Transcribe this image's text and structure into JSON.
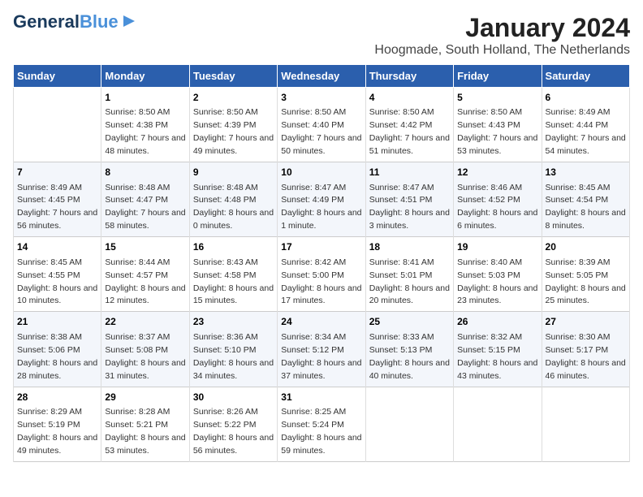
{
  "logo": {
    "line1": "General",
    "line2": "Blue"
  },
  "title": "January 2024",
  "subtitle": "Hoogmade, South Holland, The Netherlands",
  "headers": [
    "Sunday",
    "Monday",
    "Tuesday",
    "Wednesday",
    "Thursday",
    "Friday",
    "Saturday"
  ],
  "weeks": [
    [
      {
        "day": "",
        "sunrise": "",
        "sunset": "",
        "daylight": ""
      },
      {
        "day": "1",
        "sunrise": "Sunrise: 8:50 AM",
        "sunset": "Sunset: 4:38 PM",
        "daylight": "Daylight: 7 hours and 48 minutes."
      },
      {
        "day": "2",
        "sunrise": "Sunrise: 8:50 AM",
        "sunset": "Sunset: 4:39 PM",
        "daylight": "Daylight: 7 hours and 49 minutes."
      },
      {
        "day": "3",
        "sunrise": "Sunrise: 8:50 AM",
        "sunset": "Sunset: 4:40 PM",
        "daylight": "Daylight: 7 hours and 50 minutes."
      },
      {
        "day": "4",
        "sunrise": "Sunrise: 8:50 AM",
        "sunset": "Sunset: 4:42 PM",
        "daylight": "Daylight: 7 hours and 51 minutes."
      },
      {
        "day": "5",
        "sunrise": "Sunrise: 8:50 AM",
        "sunset": "Sunset: 4:43 PM",
        "daylight": "Daylight: 7 hours and 53 minutes."
      },
      {
        "day": "6",
        "sunrise": "Sunrise: 8:49 AM",
        "sunset": "Sunset: 4:44 PM",
        "daylight": "Daylight: 7 hours and 54 minutes."
      }
    ],
    [
      {
        "day": "7",
        "sunrise": "Sunrise: 8:49 AM",
        "sunset": "Sunset: 4:45 PM",
        "daylight": "Daylight: 7 hours and 56 minutes."
      },
      {
        "day": "8",
        "sunrise": "Sunrise: 8:48 AM",
        "sunset": "Sunset: 4:47 PM",
        "daylight": "Daylight: 7 hours and 58 minutes."
      },
      {
        "day": "9",
        "sunrise": "Sunrise: 8:48 AM",
        "sunset": "Sunset: 4:48 PM",
        "daylight": "Daylight: 8 hours and 0 minutes."
      },
      {
        "day": "10",
        "sunrise": "Sunrise: 8:47 AM",
        "sunset": "Sunset: 4:49 PM",
        "daylight": "Daylight: 8 hours and 1 minute."
      },
      {
        "day": "11",
        "sunrise": "Sunrise: 8:47 AM",
        "sunset": "Sunset: 4:51 PM",
        "daylight": "Daylight: 8 hours and 3 minutes."
      },
      {
        "day": "12",
        "sunrise": "Sunrise: 8:46 AM",
        "sunset": "Sunset: 4:52 PM",
        "daylight": "Daylight: 8 hours and 6 minutes."
      },
      {
        "day": "13",
        "sunrise": "Sunrise: 8:45 AM",
        "sunset": "Sunset: 4:54 PM",
        "daylight": "Daylight: 8 hours and 8 minutes."
      }
    ],
    [
      {
        "day": "14",
        "sunrise": "Sunrise: 8:45 AM",
        "sunset": "Sunset: 4:55 PM",
        "daylight": "Daylight: 8 hours and 10 minutes."
      },
      {
        "day": "15",
        "sunrise": "Sunrise: 8:44 AM",
        "sunset": "Sunset: 4:57 PM",
        "daylight": "Daylight: 8 hours and 12 minutes."
      },
      {
        "day": "16",
        "sunrise": "Sunrise: 8:43 AM",
        "sunset": "Sunset: 4:58 PM",
        "daylight": "Daylight: 8 hours and 15 minutes."
      },
      {
        "day": "17",
        "sunrise": "Sunrise: 8:42 AM",
        "sunset": "Sunset: 5:00 PM",
        "daylight": "Daylight: 8 hours and 17 minutes."
      },
      {
        "day": "18",
        "sunrise": "Sunrise: 8:41 AM",
        "sunset": "Sunset: 5:01 PM",
        "daylight": "Daylight: 8 hours and 20 minutes."
      },
      {
        "day": "19",
        "sunrise": "Sunrise: 8:40 AM",
        "sunset": "Sunset: 5:03 PM",
        "daylight": "Daylight: 8 hours and 23 minutes."
      },
      {
        "day": "20",
        "sunrise": "Sunrise: 8:39 AM",
        "sunset": "Sunset: 5:05 PM",
        "daylight": "Daylight: 8 hours and 25 minutes."
      }
    ],
    [
      {
        "day": "21",
        "sunrise": "Sunrise: 8:38 AM",
        "sunset": "Sunset: 5:06 PM",
        "daylight": "Daylight: 8 hours and 28 minutes."
      },
      {
        "day": "22",
        "sunrise": "Sunrise: 8:37 AM",
        "sunset": "Sunset: 5:08 PM",
        "daylight": "Daylight: 8 hours and 31 minutes."
      },
      {
        "day": "23",
        "sunrise": "Sunrise: 8:36 AM",
        "sunset": "Sunset: 5:10 PM",
        "daylight": "Daylight: 8 hours and 34 minutes."
      },
      {
        "day": "24",
        "sunrise": "Sunrise: 8:34 AM",
        "sunset": "Sunset: 5:12 PM",
        "daylight": "Daylight: 8 hours and 37 minutes."
      },
      {
        "day": "25",
        "sunrise": "Sunrise: 8:33 AM",
        "sunset": "Sunset: 5:13 PM",
        "daylight": "Daylight: 8 hours and 40 minutes."
      },
      {
        "day": "26",
        "sunrise": "Sunrise: 8:32 AM",
        "sunset": "Sunset: 5:15 PM",
        "daylight": "Daylight: 8 hours and 43 minutes."
      },
      {
        "day": "27",
        "sunrise": "Sunrise: 8:30 AM",
        "sunset": "Sunset: 5:17 PM",
        "daylight": "Daylight: 8 hours and 46 minutes."
      }
    ],
    [
      {
        "day": "28",
        "sunrise": "Sunrise: 8:29 AM",
        "sunset": "Sunset: 5:19 PM",
        "daylight": "Daylight: 8 hours and 49 minutes."
      },
      {
        "day": "29",
        "sunrise": "Sunrise: 8:28 AM",
        "sunset": "Sunset: 5:21 PM",
        "daylight": "Daylight: 8 hours and 53 minutes."
      },
      {
        "day": "30",
        "sunrise": "Sunrise: 8:26 AM",
        "sunset": "Sunset: 5:22 PM",
        "daylight": "Daylight: 8 hours and 56 minutes."
      },
      {
        "day": "31",
        "sunrise": "Sunrise: 8:25 AM",
        "sunset": "Sunset: 5:24 PM",
        "daylight": "Daylight: 8 hours and 59 minutes."
      },
      {
        "day": "",
        "sunrise": "",
        "sunset": "",
        "daylight": ""
      },
      {
        "day": "",
        "sunrise": "",
        "sunset": "",
        "daylight": ""
      },
      {
        "day": "",
        "sunrise": "",
        "sunset": "",
        "daylight": ""
      }
    ]
  ]
}
